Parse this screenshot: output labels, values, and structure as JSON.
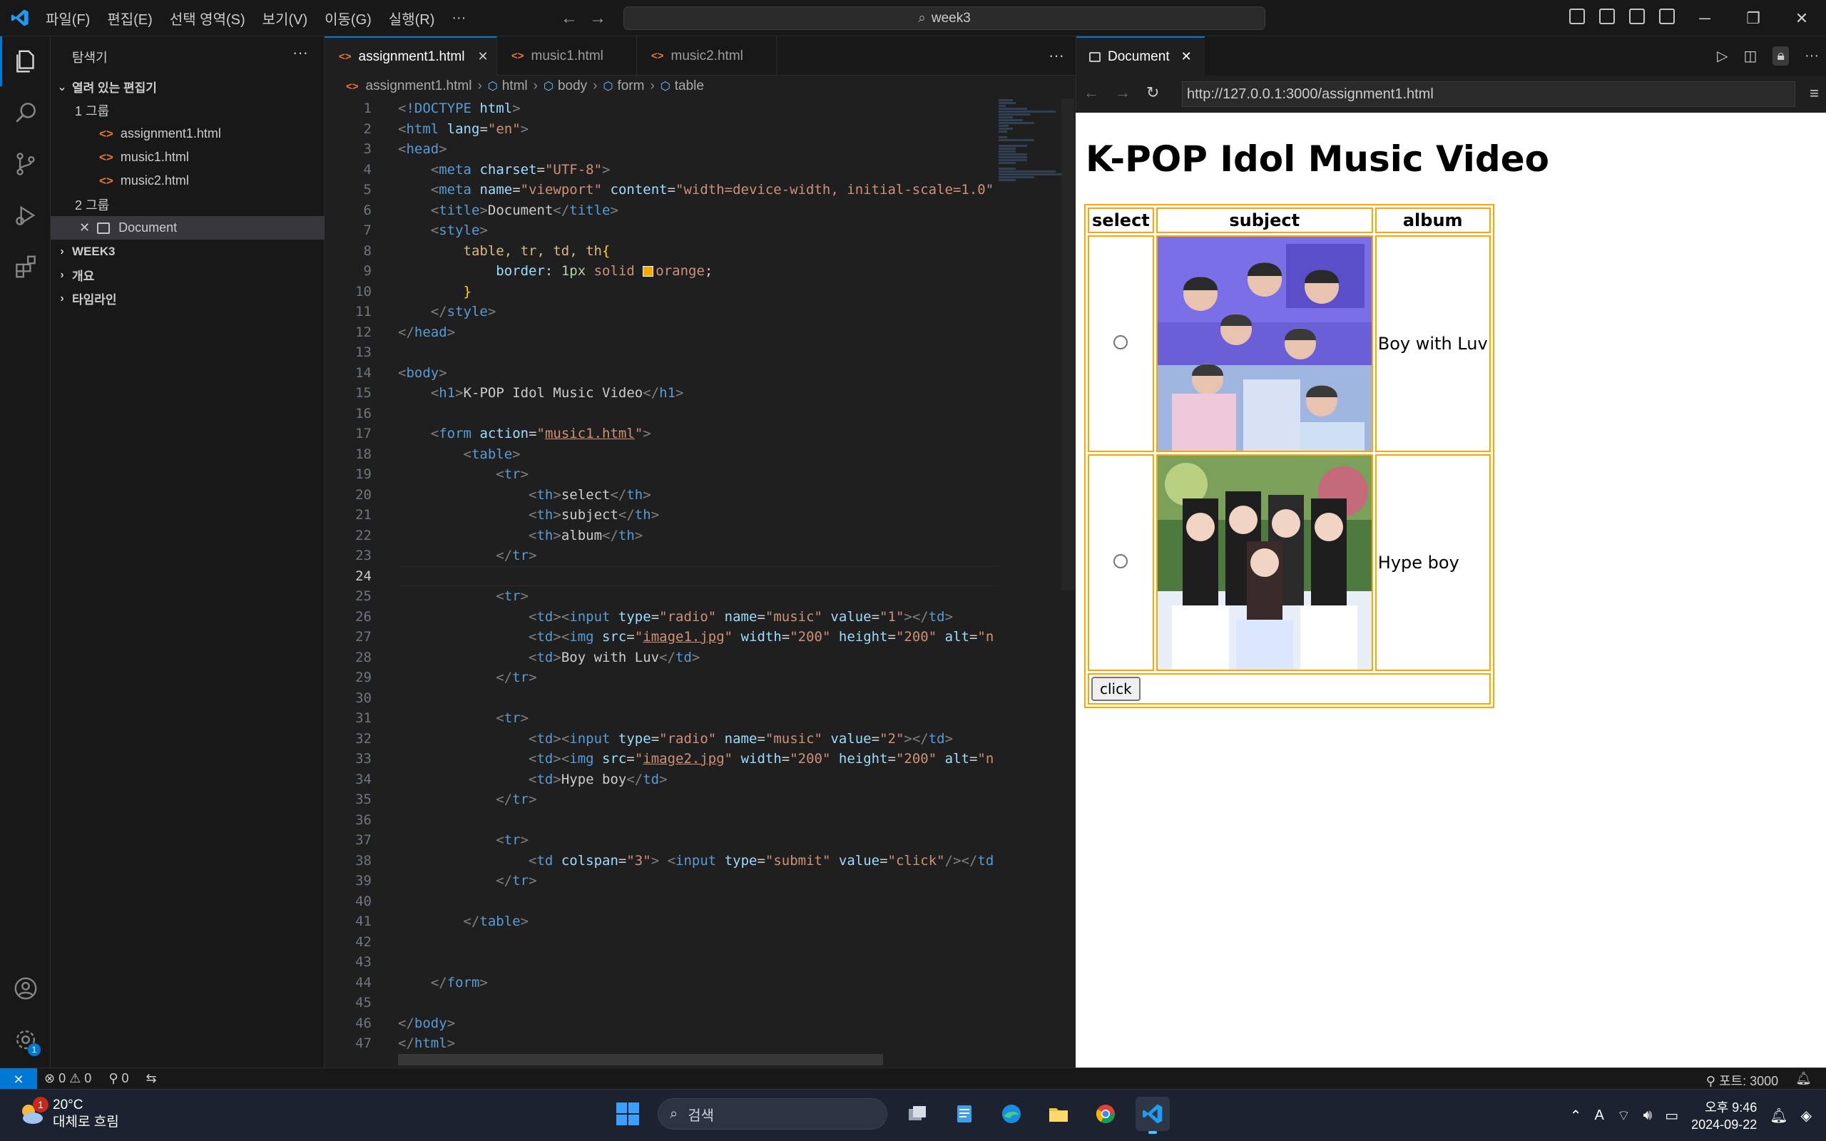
{
  "titlebar": {
    "menu": [
      "파일(F)",
      "편집(E)",
      "선택 영역(S)",
      "보기(V)",
      "이동(G)",
      "실행(R)",
      "···"
    ],
    "search_text": "week3"
  },
  "sidebar": {
    "title": "탐색기",
    "open_editors_label": "열려 있는 편집기",
    "group1_label": "1 그룹",
    "group1_files": [
      "assignment1.html",
      "music1.html",
      "music2.html"
    ],
    "group2_label": "2 그룹",
    "group2_item": "Document",
    "sections": [
      "WEEK3",
      "개요",
      "타임라인"
    ]
  },
  "editor": {
    "tabs": [
      "assignment1.html",
      "music1.html",
      "music2.html"
    ],
    "breadcrumb": [
      "assignment1.html",
      "html",
      "body",
      "form",
      "table"
    ]
  },
  "browser": {
    "tab_title": "Document",
    "url": "http://127.0.0.1:3000/assignment1.html",
    "heading": "K-POP Idol Music Video",
    "headers": [
      "select",
      "subject",
      "album"
    ],
    "rows": [
      {
        "album": "Boy with Luv"
      },
      {
        "album": "Hype boy"
      }
    ],
    "submit_label": "click"
  },
  "statusbar": {
    "errors": "0",
    "warnings": "0",
    "ports_count": "0",
    "port_label": "포트: 3000"
  },
  "taskbar": {
    "temp": "20°C",
    "weather": "대체로 흐림",
    "weather_badge": "1",
    "search_placeholder": "검색",
    "time": "오후 9:46",
    "date": "2024-09-22"
  },
  "colors": {
    "accent": "#0078d4",
    "table_border": "#ffa500"
  }
}
